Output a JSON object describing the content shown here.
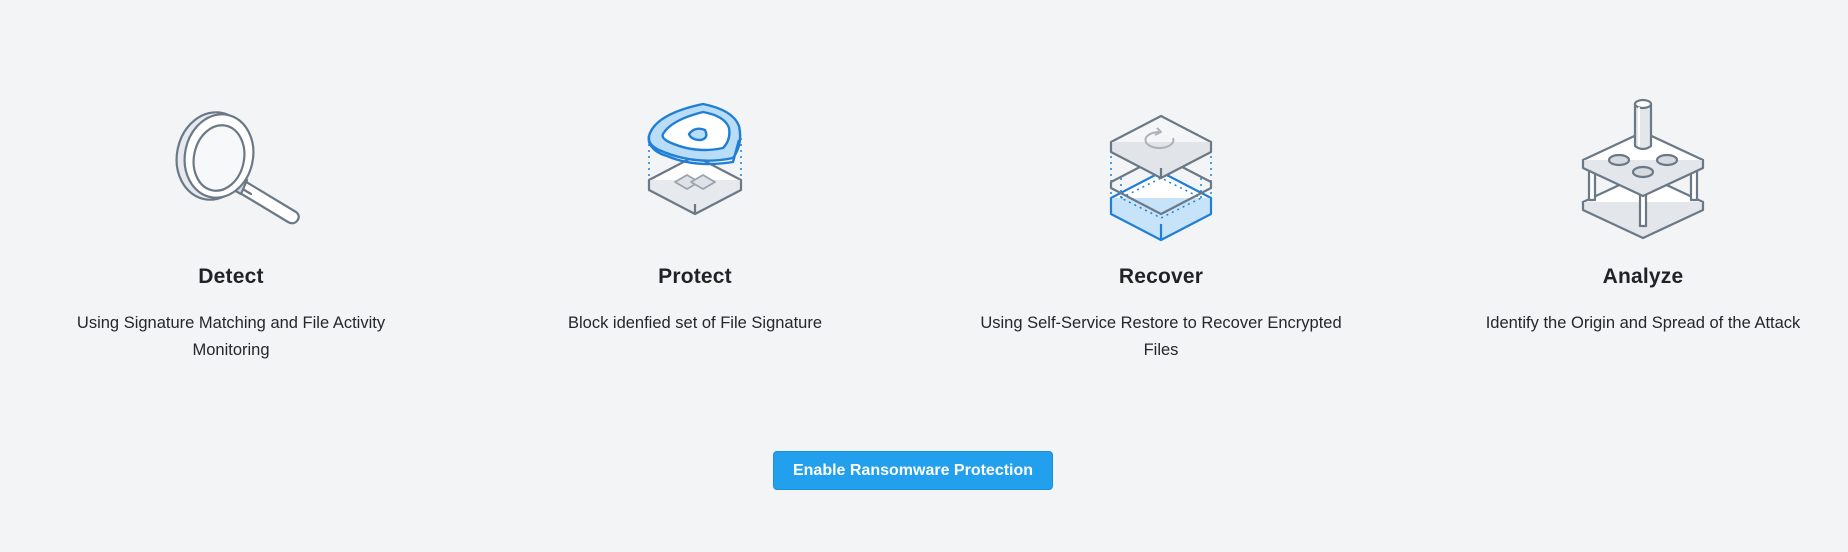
{
  "features": [
    {
      "icon": "magnifying-glass-icon",
      "title": "Detect",
      "description": "Using Signature Matching and File Activity Monitoring"
    },
    {
      "icon": "shield-icon",
      "title": "Protect",
      "description": "Block idenfied set of File Signature"
    },
    {
      "icon": "restore-stack-icon",
      "title": "Recover",
      "description": "Using Self-Service Restore to Recover Encrypted Files"
    },
    {
      "icon": "analysis-press-icon",
      "title": "Analyze",
      "description": "Identify the Origin and Spread of the Attack"
    }
  ],
  "cta": {
    "label": "Enable Ransomware Protection"
  },
  "colors": {
    "background": "#f2f4f6",
    "accent": "#22a0ee",
    "icon_stroke": "#6b7886",
    "icon_blue": "#1f7fd6"
  }
}
